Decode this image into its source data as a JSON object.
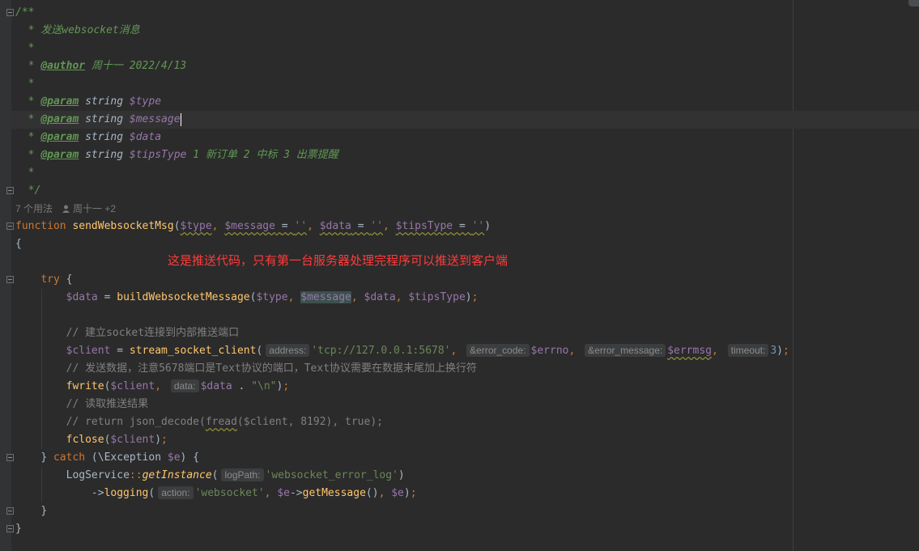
{
  "doc": {
    "open": "/**",
    "line_desc": "* 发送websocket消息",
    "star": "*",
    "author_tag": "@author",
    "author_value": "周十一 2022/4/13",
    "param_tag": "@param",
    "param_type": "string",
    "params": [
      {
        "name": "$type",
        "desc": ""
      },
      {
        "name": "$message",
        "desc": ""
      },
      {
        "name": "$data",
        "desc": ""
      },
      {
        "name": "$tipsType",
        "desc": "1 新订单 2 中标 3 出票提醒"
      }
    ],
    "close": "*/"
  },
  "usage": {
    "count": "7 个用法",
    "author": "周十一 +2"
  },
  "annotation": "这是推送代码，只有第一台服务器处理完程序可以推送到客户端",
  "code": {
    "kw_function": "function",
    "fn_name": "sendWebsocketMsg",
    "p_type": "$type",
    "p_message": "$message",
    "p_data": "$data",
    "p_tips": "$tipsType",
    "empty_str": "''",
    "brace_open": "{",
    "brace_close": "}",
    "kw_try": "try",
    "v_data": "$data",
    "fn_build": "buildWebsocketMessage",
    "v_type": "$type",
    "v_message": "$message",
    "v_tips": "$tipsType",
    "cm_socket": "// 建立socket连接到内部推送端口",
    "v_client": "$client",
    "fn_stream": "stream_socket_client",
    "hint_address": "address:",
    "s_tcp": "'tcp://127.0.0.1:5678'",
    "hint_errcode": "&error_code:",
    "v_errno": "$errno",
    "hint_errmsg": "&error_message:",
    "v_errmsg": "$errmsg",
    "hint_timeout": "timeout:",
    "n_timeout": "3",
    "cm_send": "// 发送数据，注意5678端口是Text协议的端口，Text协议需要在数据末尾加上换行符",
    "fn_fwrite": "fwrite",
    "hint_data": "data:",
    "s_newline": "\"\\n\"",
    "cm_read": "// 读取推送结果",
    "cm_return_a": "// return json_decode(",
    "cm_return_fread": "fread",
    "cm_return_b": "($client, 8192), true);",
    "fn_fclose": "fclose",
    "kw_catch": "catch",
    "cls_exception": "\\Exception",
    "v_e": "$e",
    "cls_log": "LogService",
    "fn_getinstance": "getInstance",
    "hint_logpath": "logPath:",
    "s_logname": "'websocket_error_log'",
    "fn_logging": "logging",
    "hint_action": "action:",
    "s_websocket": "'websocket'",
    "fn_getmessage": "getMessage"
  }
}
